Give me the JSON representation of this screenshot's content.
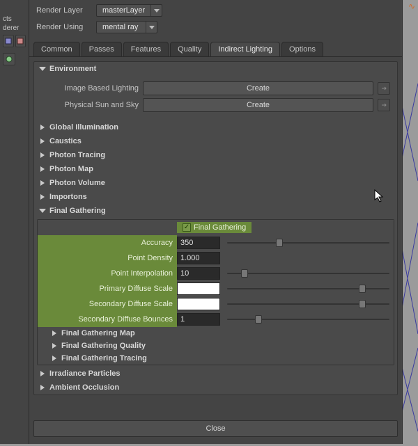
{
  "top": {
    "renderLayerLabel": "Render Layer",
    "renderLayerValue": "masterLayer",
    "renderUsingLabel": "Render Using",
    "renderUsingValue": "mental ray"
  },
  "leftStrip": {
    "cts": "cts",
    "tab0": "derer"
  },
  "tabs": [
    "Common",
    "Passes",
    "Features",
    "Quality",
    "Indirect Lighting",
    "Options"
  ],
  "activeTab": 4,
  "environment": {
    "title": "Environment",
    "ibl_label": "Image Based Lighting",
    "sun_label": "Physical Sun and Sky",
    "create": "Create"
  },
  "collapsed": {
    "gi": "Global Illumination",
    "caustics": "Caustics",
    "photonTracing": "Photon Tracing",
    "photonMap": "Photon Map",
    "photonVolume": "Photon Volume",
    "importons": "Importons"
  },
  "finalGathering": {
    "title": "Final Gathering",
    "checkbox_label": "Final Gathering",
    "accuracy_label": "Accuracy",
    "accuracy_value": "350",
    "pointDensity_label": "Point Density",
    "pointDensity_value": "1.000",
    "pointInterp_label": "Point Interpolation",
    "pointInterp_value": "10",
    "primDiffuse_label": "Primary Diffuse Scale",
    "secDiffuse_label": "Secondary Diffuse Scale",
    "secBounces_label": "Secondary Diffuse Bounces",
    "secBounces_value": "1",
    "sub_map": "Final Gathering Map",
    "sub_quality": "Final Gathering Quality",
    "sub_tracing": "Final Gathering Tracing"
  },
  "bottomCollapsed": {
    "irradiance": "Irradiance Particles",
    "ao": "Ambient Occlusion"
  },
  "closeLabel": "Close"
}
